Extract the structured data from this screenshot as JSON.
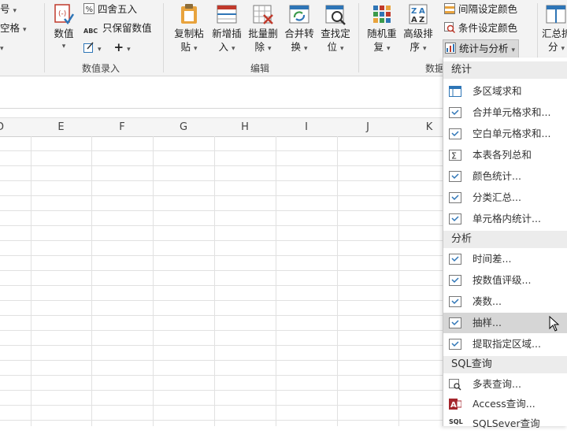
{
  "ribbon": {
    "left_cut": [
      {
        "label": "号",
        "arrow": "▾"
      },
      {
        "label": "空格",
        "arrow": "▾"
      }
    ],
    "group1": {
      "label": "数值录入",
      "value_button": {
        "label": "数值"
      },
      "round_item": {
        "label": "四舍五入",
        "icon_text": "%"
      },
      "keep_value_item": {
        "label": "只保留数值",
        "icon_text": "ABC"
      }
    },
    "group2": {
      "label": "编辑",
      "buttons": [
        {
          "line1": "复制粘",
          "line2": "贴"
        },
        {
          "line1": "新增插",
          "line2": "入"
        },
        {
          "line1": "批量删",
          "line2": "除"
        },
        {
          "line1": "合并转",
          "line2": "换"
        },
        {
          "line1": "查找定",
          "line2": "位"
        }
      ]
    },
    "group3": {
      "label": "数据",
      "buttons": [
        {
          "line1": "随机重",
          "line2": "复"
        },
        {
          "line1": "高级排",
          "line2": "序"
        }
      ],
      "small": [
        {
          "label": "间隔设定颜色"
        },
        {
          "label": "条件设定颜色"
        },
        {
          "label": "统计与分析"
        }
      ]
    },
    "summary_button": {
      "line1": "汇总拆",
      "line2": "分"
    }
  },
  "sheet": {
    "columns": [
      "D",
      "E",
      "F",
      "G",
      "H",
      "I",
      "J",
      "K"
    ]
  },
  "menu": {
    "sections": [
      {
        "title": "统计",
        "items": [
          "多区域求和",
          "合并单元格求和...",
          "空白单元格求和...",
          "本表各列总和",
          "颜色统计...",
          "分类汇总...",
          "单元格内统计..."
        ]
      },
      {
        "title": "分析",
        "items": [
          "时间差...",
          "按数值评级...",
          "凑数...",
          "抽样...",
          "提取指定区域..."
        ]
      },
      {
        "title": "SQL查询",
        "items": [
          "多表查询...",
          "Access查询...",
          "SQLSever查询"
        ]
      }
    ],
    "icon_texts": {
      "sigma": "Σ",
      "access": "A",
      "sql": "SQL"
    },
    "hovered_item": "抽样..."
  },
  "colors": {
    "accent_blue": "#2e75b6",
    "icon_red": "#c0392b",
    "icon_orange": "#e8a33d",
    "hover_gray": "#d6d6d6"
  }
}
